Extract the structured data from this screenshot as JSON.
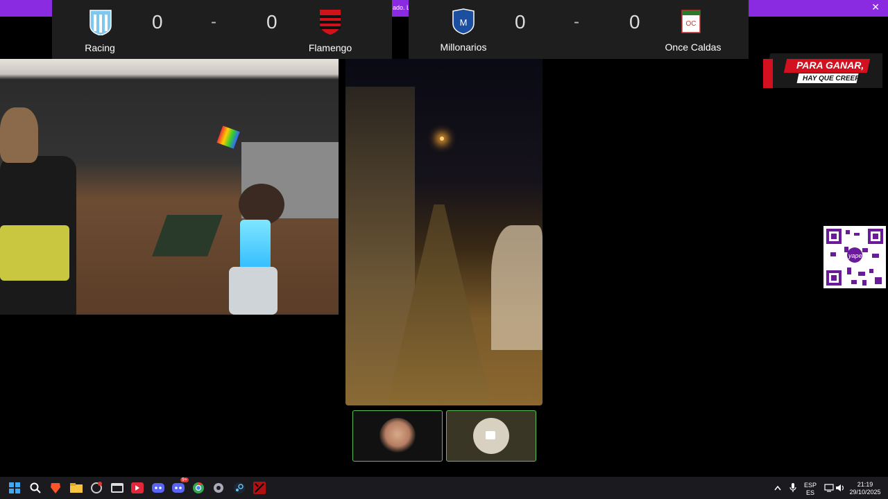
{
  "banner": {
    "message": "ado. L",
    "close_glyph": "✕"
  },
  "scoreboards": [
    {
      "home": "Racing",
      "away": "Flamengo",
      "home_score": "0",
      "away_score": "0",
      "separator": "-"
    },
    {
      "home": "Millonarios",
      "away": "Once Caldas",
      "home_score": "0",
      "away_score": "0",
      "separator": "-"
    }
  ],
  "promo": {
    "line1": "PARA GANAR,",
    "line2": "HAY QUE CREER"
  },
  "qr": {
    "label": "yape"
  },
  "taskbar": {
    "icons": [
      "windows-start-icon",
      "search-icon",
      "brave-icon",
      "file-explorer-icon",
      "app-icon",
      "media-icon",
      "red-app-icon",
      "discord-icon",
      "discord-notify-icon",
      "chrome-icon",
      "settings-icon",
      "steam-icon",
      "game-icon"
    ],
    "discord_badge": "9+",
    "lang_top": "ESP",
    "lang_bottom": "ES",
    "time": "21:19",
    "date": "29/10/2025"
  },
  "colors": {
    "accent": "#8a2be2",
    "thumb_border": "#5bbf5b"
  }
}
